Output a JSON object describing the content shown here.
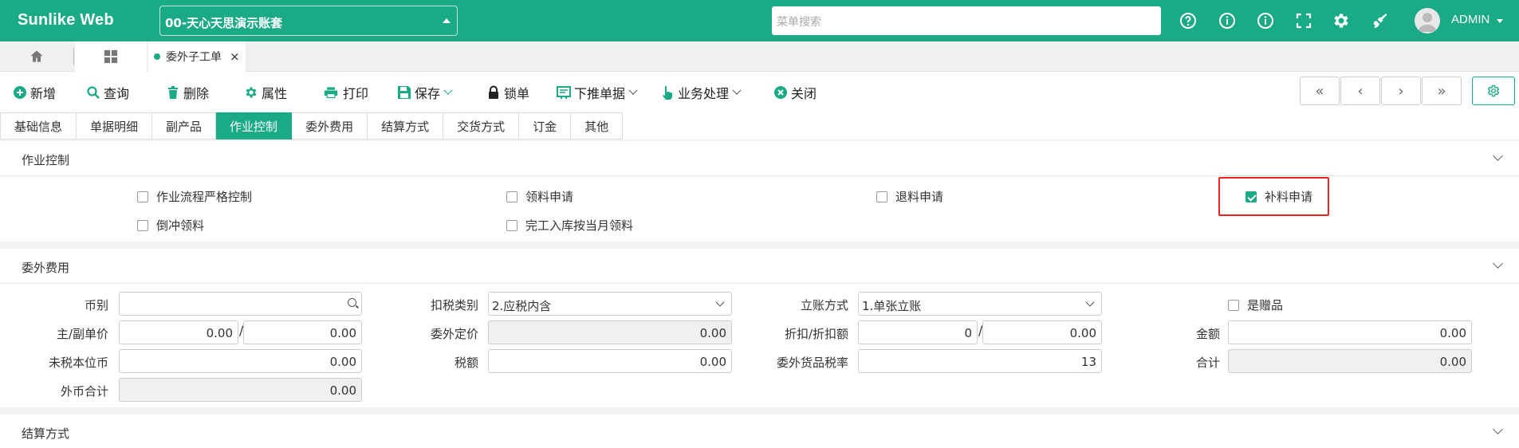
{
  "app": {
    "brand": "Sunlike Web",
    "account": "00-天心天思演示账套",
    "search_placeholder": "菜单搜索",
    "user": "ADMIN"
  },
  "colors": {
    "primary": "#1aaa86",
    "highlight": "#e22222"
  },
  "topbar_icons": [
    "help-icon",
    "info-icon",
    "info-alt-icon",
    "fullscreen-icon",
    "settings-icon",
    "clean-icon"
  ],
  "tabs": {
    "document_tab": "委外子工单",
    "close": "×"
  },
  "toolbar": {
    "new": "新增",
    "query": "查询",
    "delete": "删除",
    "props": "属性",
    "print": "打印",
    "save": "保存",
    "lock": "锁单",
    "push_down": "下推单据",
    "business": "业务处理",
    "close": "关闭",
    "nav": [
      "«",
      "‹",
      "›",
      "»"
    ]
  },
  "form_tabs": [
    "基础信息",
    "单据明细",
    "副产品",
    "作业控制",
    "委外费用",
    "结算方式",
    "交货方式",
    "订金",
    "其他"
  ],
  "active_form_tab": "作业控制",
  "sections": {
    "job_control": {
      "title": "作业控制",
      "checkboxes": [
        {
          "label": "作业流程严格控制",
          "checked": false
        },
        {
          "label": "领料申请",
          "checked": false
        },
        {
          "label": "退料申请",
          "checked": false
        },
        {
          "label": "补料申请",
          "checked": true
        },
        {
          "label": "倒冲领料",
          "checked": false
        },
        {
          "label": "完工入库按当月领料",
          "checked": false
        }
      ]
    },
    "outsource_fee": {
      "title": "委外费用",
      "currency": {
        "label": "币别",
        "value": ""
      },
      "tax_type": {
        "label": "扣税类别",
        "value": "2.应税内含"
      },
      "account_mode": {
        "label": "立账方式",
        "value": "1.单张立账"
      },
      "is_gift": {
        "label": "是赠品",
        "checked": false
      },
      "unit_price": {
        "label": "主/副单价",
        "main": "0.00",
        "sub": "0.00"
      },
      "outsource_price": {
        "label": "委外定价",
        "value": "0.00"
      },
      "discount": {
        "label": "折扣/折扣额",
        "rate": "0",
        "amount": "0.00"
      },
      "amount": {
        "label": "金额",
        "value": "0.00"
      },
      "untaxed_local": {
        "label": "未税本位币",
        "value": "0.00"
      },
      "tax": {
        "label": "税额",
        "value": "0.00"
      },
      "goods_tax_rate": {
        "label": "委外货品税率",
        "value": "13"
      },
      "total": {
        "label": "合计",
        "value": "0.00"
      },
      "foreign_total": {
        "label": "外币合计",
        "value": "0.00"
      }
    },
    "settlement": {
      "title": "结算方式"
    }
  }
}
